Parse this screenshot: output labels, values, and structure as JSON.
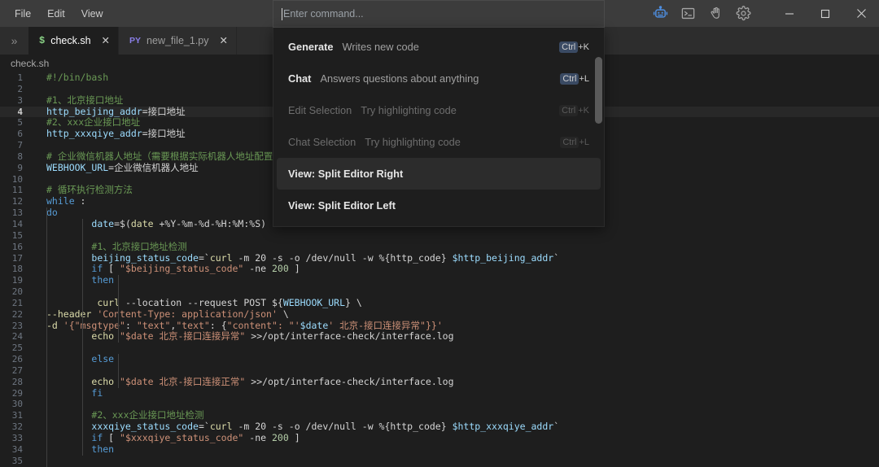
{
  "window": {
    "menu": [
      {
        "label": "File",
        "name": "menu-file"
      },
      {
        "label": "Edit",
        "name": "menu-edit"
      },
      {
        "label": "View",
        "name": "menu-view"
      }
    ],
    "icons": [
      {
        "name": "robot-icon",
        "label": "robot"
      },
      {
        "name": "terminal-icon",
        "label": "terminal"
      },
      {
        "name": "hand-wave-icon",
        "label": "hand"
      },
      {
        "name": "gear-icon",
        "label": "settings"
      }
    ],
    "controls": [
      {
        "name": "minimize-button",
        "glyph": "minimize"
      },
      {
        "name": "maximize-button",
        "glyph": "maximize"
      },
      {
        "name": "close-button",
        "glyph": "close"
      }
    ],
    "accent_color": "#3f7fd6",
    "titlebar_color": "#3c3c3c"
  },
  "tabbar": {
    "overflow_glyph": "»",
    "tabs": [
      {
        "icon_label": "$",
        "icon_kind": "sh",
        "title": "check.sh",
        "active": true,
        "close_glyph": "✕"
      },
      {
        "icon_label": "PY",
        "icon_kind": "py",
        "title": "new_file_1.py",
        "active": false,
        "close_glyph": "✕"
      }
    ]
  },
  "breadcrumb": {
    "path": "check.sh"
  },
  "palette": {
    "placeholder": "Enter command...",
    "value": "",
    "items": [
      {
        "title": "Generate",
        "desc": "Writes new code",
        "shortcut_mod": "Ctrl",
        "shortcut_key": "+K",
        "state": "normal",
        "selected": false
      },
      {
        "title": "Chat",
        "desc": "Answers questions about anything",
        "shortcut_mod": "Ctrl",
        "shortcut_key": "+L",
        "state": "normal",
        "selected": false
      },
      {
        "title": "Edit Selection",
        "desc": "Try highlighting code",
        "shortcut_mod": "Ctrl",
        "shortcut_key": "+K",
        "state": "disabled",
        "selected": false
      },
      {
        "title": "Chat Selection",
        "desc": "Try highlighting code",
        "shortcut_mod": "Ctrl",
        "shortcut_key": "+L",
        "state": "disabled",
        "selected": false
      },
      {
        "title": "View: Split Editor Right",
        "desc": "",
        "shortcut_mod": "",
        "shortcut_key": "",
        "state": "normal",
        "selected": true
      },
      {
        "title": "View: Split Editor Left",
        "desc": "",
        "shortcut_mod": "",
        "shortcut_key": "",
        "state": "normal",
        "selected": false
      }
    ]
  },
  "editor": {
    "language": "shell",
    "current_line": 4,
    "first_line": 1,
    "last_visible_line": 35,
    "lines": [
      {
        "n": 1,
        "tokens": [
          {
            "t": "#!/bin/bash",
            "c": "cm"
          }
        ]
      },
      {
        "n": 2,
        "tokens": []
      },
      {
        "n": 3,
        "tokens": [
          {
            "t": "#1、北京接口地址",
            "c": "cm"
          }
        ]
      },
      {
        "n": 4,
        "tokens": [
          {
            "t": "http_beijing_addr",
            "c": "var"
          },
          {
            "t": "=接口地址",
            "c": "pl"
          }
        ]
      },
      {
        "n": 5,
        "tokens": [
          {
            "t": "#2、xxx企业接口地址",
            "c": "cm"
          }
        ]
      },
      {
        "n": 6,
        "tokens": [
          {
            "t": "http_xxxqiye_addr",
            "c": "var"
          },
          {
            "t": "=接口地址",
            "c": "pl"
          }
        ]
      },
      {
        "n": 7,
        "tokens": []
      },
      {
        "n": 8,
        "tokens": [
          {
            "t": "# 企业微信机器人地址（需要根据实际机器人地址配置）",
            "c": "cm"
          }
        ]
      },
      {
        "n": 9,
        "tokens": [
          {
            "t": "WEBHOOK_URL",
            "c": "var"
          },
          {
            "t": "=企业微信机器人地址",
            "c": "pl"
          }
        ]
      },
      {
        "n": 10,
        "tokens": []
      },
      {
        "n": 11,
        "tokens": [
          {
            "t": "# 循环执行检测方法",
            "c": "cm"
          }
        ]
      },
      {
        "n": 12,
        "tokens": [
          {
            "t": "while",
            "c": "kw"
          },
          {
            "t": " :",
            "c": "pl"
          }
        ]
      },
      {
        "n": 13,
        "tokens": [
          {
            "t": "do",
            "c": "kw"
          }
        ]
      },
      {
        "n": 14,
        "tokens": [
          {
            "t": "        ",
            "c": "pl"
          },
          {
            "t": "date",
            "c": "var"
          },
          {
            "t": "=$(",
            "c": "pl"
          },
          {
            "t": "date",
            "c": "fn"
          },
          {
            "t": " +%Y-%m-%d-%H:%M:%S)",
            "c": "pl"
          }
        ]
      },
      {
        "n": 15,
        "tokens": []
      },
      {
        "n": 16,
        "tokens": [
          {
            "t": "        ",
            "c": "pl"
          },
          {
            "t": "#1、北京接口地址检测",
            "c": "cm"
          }
        ]
      },
      {
        "n": 17,
        "tokens": [
          {
            "t": "        ",
            "c": "pl"
          },
          {
            "t": "beijing_status_code",
            "c": "var"
          },
          {
            "t": "=`",
            "c": "pl"
          },
          {
            "t": "curl",
            "c": "fn"
          },
          {
            "t": " -m ",
            "c": "pl"
          },
          {
            "t": "20",
            "c": "pl"
          },
          {
            "t": " -s -o /dev/null -w %{http_code} ",
            "c": "pl"
          },
          {
            "t": "$http_beijing_addr",
            "c": "var"
          },
          {
            "t": "`",
            "c": "pl"
          }
        ]
      },
      {
        "n": 18,
        "tokens": [
          {
            "t": "        ",
            "c": "pl"
          },
          {
            "t": "if",
            "c": "kw"
          },
          {
            "t": " [ ",
            "c": "pl"
          },
          {
            "t": "\"$beijing_status_code\"",
            "c": "str"
          },
          {
            "t": " -ne ",
            "c": "pl"
          },
          {
            "t": "200",
            "c": "num"
          },
          {
            "t": " ]",
            "c": "pl"
          }
        ]
      },
      {
        "n": 19,
        "tokens": [
          {
            "t": "        ",
            "c": "pl"
          },
          {
            "t": "then",
            "c": "kw"
          }
        ]
      },
      {
        "n": 20,
        "tokens": []
      },
      {
        "n": 21,
        "tokens": [
          {
            "t": "         ",
            "c": "pl"
          },
          {
            "t": "curl",
            "c": "fn"
          },
          {
            "t": " --location --request ",
            "c": "pl"
          },
          {
            "t": "POST",
            "c": "pl"
          },
          {
            "t": " ${",
            "c": "pl"
          },
          {
            "t": "WEBHOOK_URL",
            "c": "var"
          },
          {
            "t": "} \\",
            "c": "pl"
          }
        ]
      },
      {
        "n": 22,
        "tokens": [
          {
            "t": "--header",
            "c": "fn"
          },
          {
            "t": " ",
            "c": "pl"
          },
          {
            "t": "'Content-Type: application/json'",
            "c": "str"
          },
          {
            "t": " \\",
            "c": "pl"
          }
        ]
      },
      {
        "n": 23,
        "tokens": [
          {
            "t": "-d",
            "c": "fn"
          },
          {
            "t": " ",
            "c": "pl"
          },
          {
            "t": "'{",
            "c": "str"
          },
          {
            "t": "\"msgtype\"",
            "c": "str"
          },
          {
            "t": ": ",
            "c": "pl"
          },
          {
            "t": "\"text\"",
            "c": "str"
          },
          {
            "t": ",",
            "c": "pl"
          },
          {
            "t": "\"text\"",
            "c": "str"
          },
          {
            "t": ": {",
            "c": "pl"
          },
          {
            "t": "\"content\"",
            "c": "str"
          },
          {
            "t": ": \"'",
            "c": "str"
          },
          {
            "t": "$date",
            "c": "var"
          },
          {
            "t": "' 北京-接口连接异常\"}}'",
            "c": "str"
          }
        ]
      },
      {
        "n": 24,
        "tokens": [
          {
            "t": "        ",
            "c": "pl"
          },
          {
            "t": "echo",
            "c": "fn"
          },
          {
            "t": " ",
            "c": "pl"
          },
          {
            "t": "\"$date 北京-接口连接异常\"",
            "c": "str"
          },
          {
            "t": " >>/opt/interface-check/interface.log",
            "c": "pl"
          }
        ]
      },
      {
        "n": 25,
        "tokens": []
      },
      {
        "n": 26,
        "tokens": [
          {
            "t": "        ",
            "c": "pl"
          },
          {
            "t": "else",
            "c": "kw"
          }
        ]
      },
      {
        "n": 27,
        "tokens": []
      },
      {
        "n": 28,
        "tokens": [
          {
            "t": "        ",
            "c": "pl"
          },
          {
            "t": "echo",
            "c": "fn"
          },
          {
            "t": " ",
            "c": "pl"
          },
          {
            "t": "\"$date 北京-接口连接正常\"",
            "c": "str"
          },
          {
            "t": " >>/opt/interface-check/interface.log",
            "c": "pl"
          }
        ]
      },
      {
        "n": 29,
        "tokens": [
          {
            "t": "        ",
            "c": "pl"
          },
          {
            "t": "fi",
            "c": "kw"
          }
        ]
      },
      {
        "n": 30,
        "tokens": []
      },
      {
        "n": 31,
        "tokens": [
          {
            "t": "        ",
            "c": "pl"
          },
          {
            "t": "#2、xxx企业接口地址检测",
            "c": "cm"
          }
        ]
      },
      {
        "n": 32,
        "tokens": [
          {
            "t": "        ",
            "c": "pl"
          },
          {
            "t": "xxxqiye_status_code",
            "c": "var"
          },
          {
            "t": "=`",
            "c": "pl"
          },
          {
            "t": "curl",
            "c": "fn"
          },
          {
            "t": " -m ",
            "c": "pl"
          },
          {
            "t": "20",
            "c": "pl"
          },
          {
            "t": " -s -o /dev/null -w %{http_code} ",
            "c": "pl"
          },
          {
            "t": "$http_xxxqiye_addr",
            "c": "var"
          },
          {
            "t": "`",
            "c": "pl"
          }
        ]
      },
      {
        "n": 33,
        "tokens": [
          {
            "t": "        ",
            "c": "pl"
          },
          {
            "t": "if",
            "c": "kw"
          },
          {
            "t": " [ ",
            "c": "pl"
          },
          {
            "t": "\"$xxxqiye_status_code\"",
            "c": "str"
          },
          {
            "t": " -ne ",
            "c": "pl"
          },
          {
            "t": "200",
            "c": "num"
          },
          {
            "t": " ]",
            "c": "pl"
          }
        ]
      },
      {
        "n": 34,
        "tokens": [
          {
            "t": "        ",
            "c": "pl"
          },
          {
            "t": "then",
            "c": "kw"
          }
        ]
      },
      {
        "n": 35,
        "tokens": []
      }
    ]
  }
}
